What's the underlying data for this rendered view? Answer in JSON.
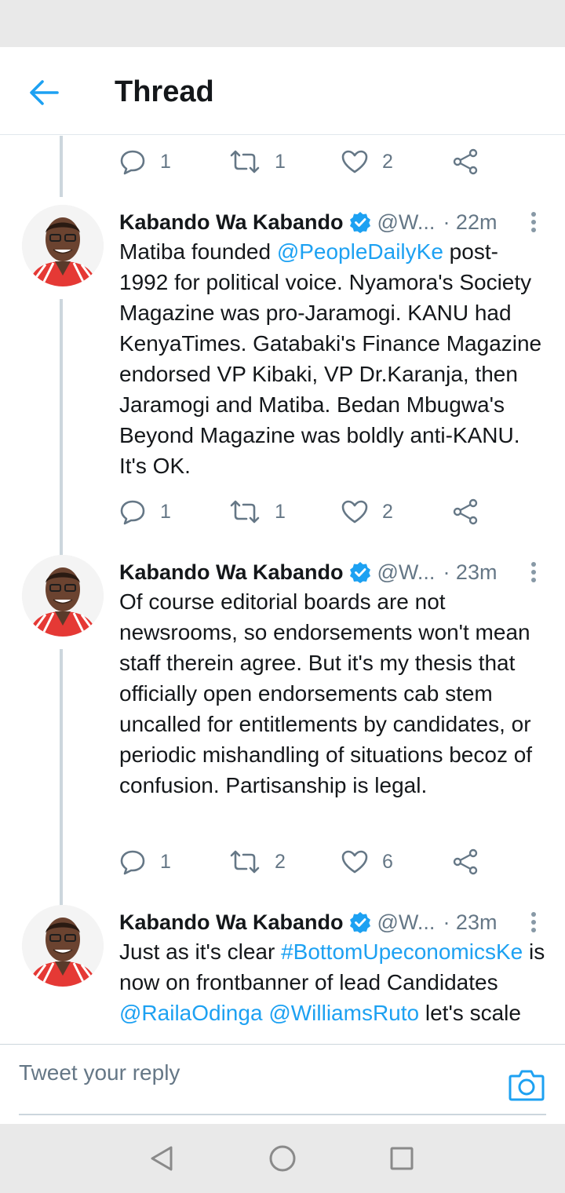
{
  "header": {
    "title": "Thread",
    "back_icon": "arrow-left-icon"
  },
  "colors": {
    "accent": "#1da1f2",
    "text": "#14171a",
    "muted": "#657786",
    "line": "#ccd6dd"
  },
  "top_actions": {
    "replies": "1",
    "retweets": "1",
    "likes": "2"
  },
  "tweets": [
    {
      "author": "Kabando Wa Kabando",
      "handle": "@W...",
      "time": "· 22m",
      "text_parts": [
        "Matiba founded ",
        "@PeopleDailyKe",
        " post-1992 for political voice. Nyamora's Society Magazine was pro-Jaramogi. KANU had KenyaTimes.  Gatabaki's Finance Magazine endorsed VP Kibaki, VP Dr.Karanja, then Jaramogi and Matiba. Bedan Mbugwa's Beyond Magazine was boldly anti-KANU. It's OK."
      ],
      "replies": "1",
      "retweets": "1",
      "likes": "2"
    },
    {
      "author": "Kabando Wa Kabando",
      "handle": "@W...",
      "time": "· 23m",
      "text": "Of course editorial boards are not newsrooms, so endorsements won't mean staff therein agree. But it's my thesis that officially open endorsements cab stem uncalled for entitlements by candidates, or periodic mishandling of situations becoz of confusion. Partisanship is legal.",
      "replies": "1",
      "retweets": "2",
      "likes": "6"
    },
    {
      "author": "Kabando Wa Kabando",
      "handle": "@W...",
      "time": "· 23m",
      "text_parts": [
        "Just as it's clear ",
        "#BottomUpeconomicsKe",
        " is now on frontbanner of lead Candidates ",
        "@RailaOdinga",
        " ",
        "@WilliamsRuto",
        " let's scale"
      ]
    }
  ],
  "reply_bar": {
    "placeholder": "Tweet your reply",
    "camera_icon": "camera-icon"
  },
  "nav": {
    "back": "triangle-back-icon",
    "home": "circle-home-icon",
    "recents": "square-recents-icon"
  }
}
